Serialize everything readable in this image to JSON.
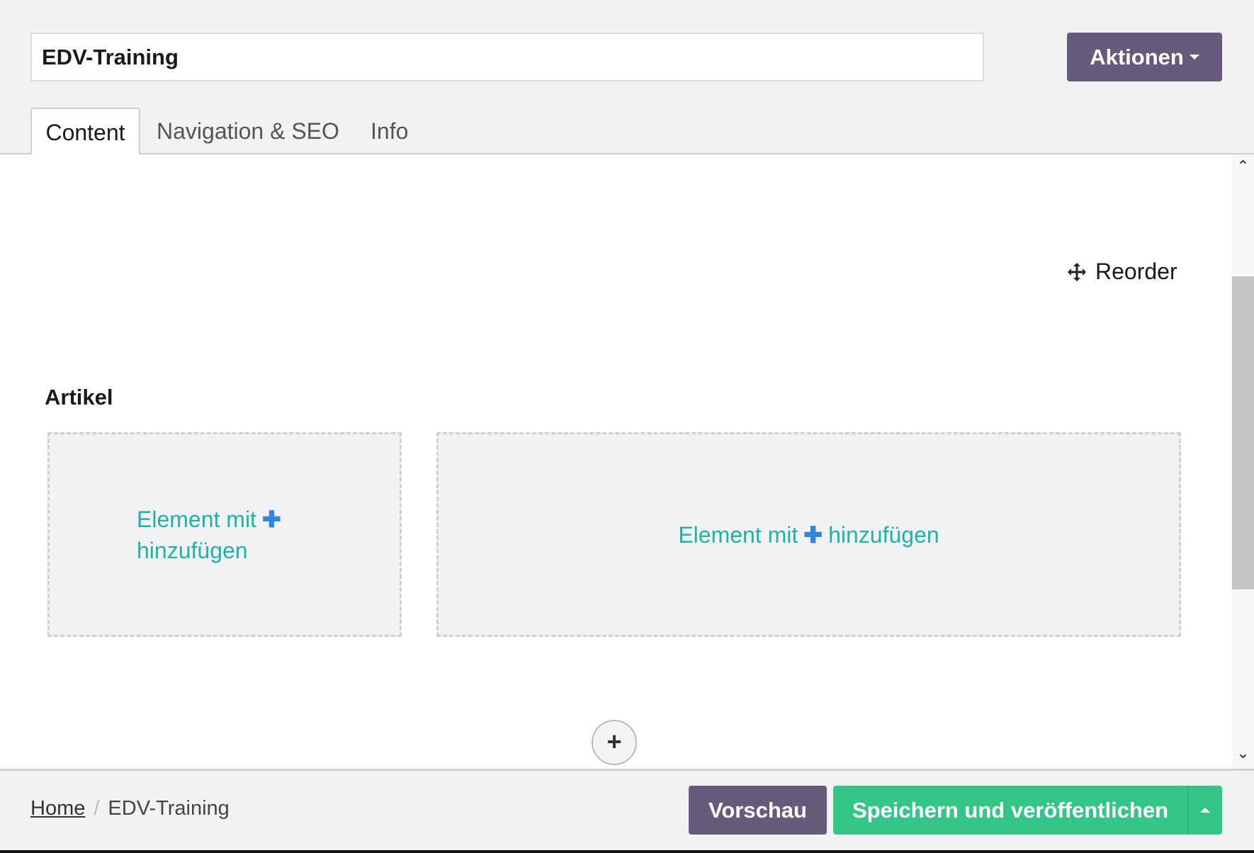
{
  "header": {
    "title": "EDV-Training",
    "actions_label": "Aktionen"
  },
  "tabs": [
    {
      "label": "Content",
      "active": true
    },
    {
      "label": "Navigation & SEO"
    },
    {
      "label": "Info"
    }
  ],
  "main": {
    "reorder_label": "Reorder",
    "section_title": "Artikel",
    "slots": [
      {
        "text_before": "Element mit",
        "text_after": "hinzufügen"
      },
      {
        "text_before": "Element mit",
        "text_after": "hinzufügen"
      }
    ]
  },
  "footer": {
    "breadcrumb": [
      "Home",
      "EDV-Training"
    ],
    "breadcrumb_separator": "/",
    "preview_label": "Vorschau",
    "publish_label": "Speichern und veröffentlichen"
  },
  "colors": {
    "primary": "#665b7a",
    "success": "#34c686",
    "link": "#1fb3a6",
    "plus": "#2e86de"
  }
}
